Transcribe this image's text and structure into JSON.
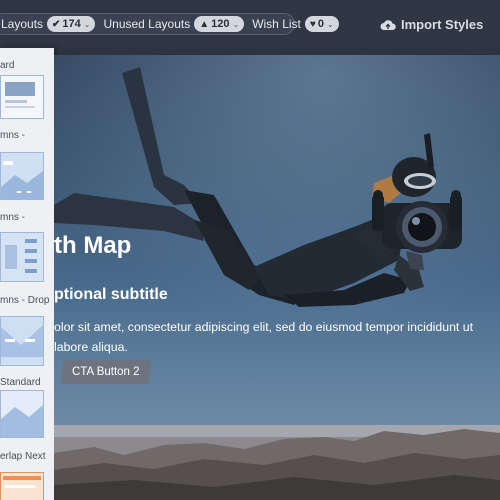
{
  "topbar": {
    "layouts_label": "Layouts",
    "layouts_count": "174",
    "unused_label": "Unused Layouts",
    "unused_count": "120",
    "wishlist_label": "Wish List",
    "wishlist_count": "0",
    "import_label": "Import Styles"
  },
  "sidebar": {
    "items": [
      {
        "label": "ard"
      },
      {
        "label": "mns -"
      },
      {
        "label": "mns -"
      },
      {
        "label": "mns - Drop"
      },
      {
        "label": "Standard"
      },
      {
        "label": "erlap Next"
      }
    ]
  },
  "hero": {
    "title": "th Map",
    "subtitle": "ptional subtitle",
    "body": "olor sit amet, consectetur adipiscing elit, sed do eiusmod tempor incididunt ut labore aliqua.",
    "cta_label": "CTA Button 2"
  },
  "colors": {
    "topbar": "#2f3644",
    "sidebar": "#eef0f3",
    "cta": "#6d7480",
    "hero_deep": "#31445d",
    "hero_light": "#6d8aa6"
  }
}
